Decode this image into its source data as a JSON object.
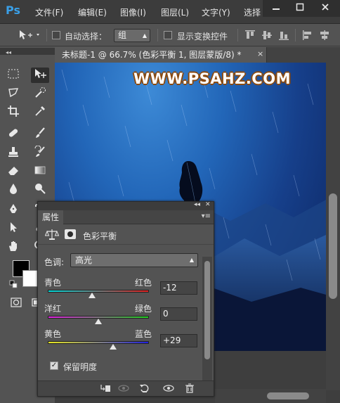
{
  "app": {
    "logo": "Ps",
    "menu": [
      "文件(F)",
      "编辑(E)",
      "图像(I)",
      "图层(L)",
      "文字(Y)",
      "选择"
    ],
    "window_controls": [
      "minimize-icon",
      "maximize-icon",
      "close-icon"
    ]
  },
  "options": {
    "auto_select_label": "自动选择：",
    "auto_select_checked": false,
    "group_value": "组",
    "show_transform_label": "显示变换控件",
    "show_transform_checked": false
  },
  "document": {
    "tab_title": "未标题-1 @ 66.7% (色彩平衡 1, 图层蒙版/8) *",
    "close_symbol": "×",
    "watermark": "WWW.PSAHZ.COM"
  },
  "tools": [
    "marquee-icon",
    "move-icon",
    "lasso-icon",
    "quick-select-icon",
    "crop-icon",
    "eyedropper-icon",
    "healing-brush-icon",
    "brush-icon",
    "clone-stamp-icon",
    "history-brush-icon",
    "eraser-icon",
    "gradient-icon",
    "blur-icon",
    "dodge-icon",
    "pen-icon",
    "type-icon",
    "path-select-icon",
    "shape-icon",
    "hand-icon",
    "zoom-icon",
    "quick-mask-icon",
    "screen-mode-icon"
  ],
  "colors": {
    "foreground": "#000000",
    "background": "#ffffff"
  },
  "properties_panel": {
    "tab_label": "属性",
    "adjustment_title": "色彩平衡",
    "tone_label": "色调:",
    "tone_value": "高光",
    "sliders": [
      {
        "left": "青色",
        "right": "红色",
        "value": "-12",
        "level": -12
      },
      {
        "left": "洋红",
        "right": "绿色",
        "value": "0",
        "level": 0
      },
      {
        "left": "黄色",
        "right": "蓝色",
        "value": "+29",
        "level": 29
      }
    ],
    "slider_range": [
      -100,
      100
    ],
    "preserve_label": "保留明度",
    "preserve_checked": true,
    "footer_icons": [
      "clip-to-layer-icon",
      "view-previous-icon",
      "reset-icon",
      "visibility-icon",
      "trash-icon"
    ]
  }
}
